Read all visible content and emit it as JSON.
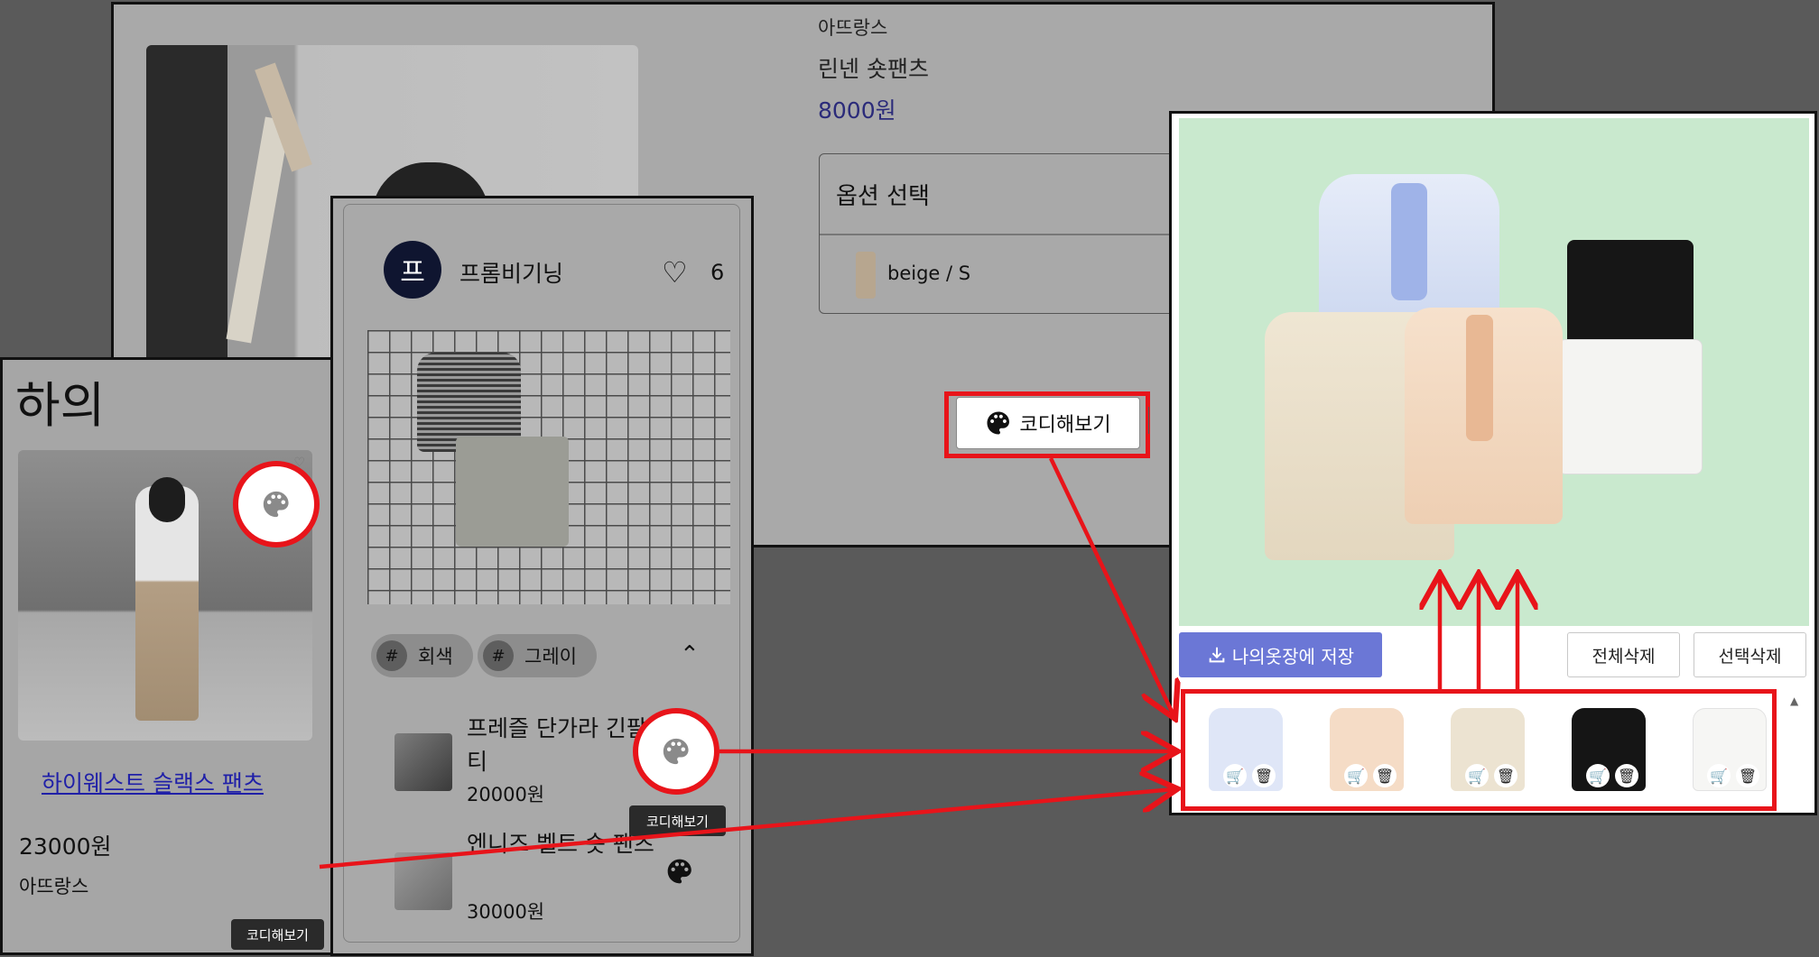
{
  "product_page": {
    "brand": "아뜨랑스",
    "name": "린넨 숏팬츠",
    "price": "8000원",
    "option_label": "옵션 선택",
    "option_value": "beige / S",
    "coordi_button": "코디해보기"
  },
  "category_card": {
    "title": "하의",
    "product_name": "하이웨스트 슬랙스 팬츠",
    "price": "23000원",
    "brand": "아뜨랑스",
    "tooltip": "코디해보기"
  },
  "coordi_card": {
    "avatar_initial": "프",
    "user_name": "프롬비기닝",
    "likes": "6",
    "tags": [
      "회색",
      "그레이"
    ],
    "tag_symbol": "#",
    "items": [
      {
        "name": "프레즐 단가라 긴팔티",
        "price": "20000원"
      },
      {
        "name": "엔니즈 벨트 숏 팬츠",
        "price": "30000원"
      }
    ],
    "tooltip": "코디해보기"
  },
  "editor": {
    "save_button": "나의옷장에 저장",
    "delete_all_button": "전체삭제",
    "delete_selected_button": "선택삭제",
    "strip_items": [
      {
        "icon": "blue-blouse",
        "color": "#dfe6f7"
      },
      {
        "icon": "peach-blouse",
        "color": "#f5dcc6"
      },
      {
        "icon": "cream-shirt",
        "color": "#ece3d1"
      },
      {
        "icon": "black-shorts",
        "color": "#151515"
      },
      {
        "icon": "white-shorts",
        "color": "#f6f6f4"
      }
    ],
    "canvas_color": "#c9e9ce"
  },
  "colors": {
    "highlight": "#e8141a",
    "save_button": "#6b77d6",
    "panel_dim": "#a9a9a9",
    "backdrop": "#5a5a5a"
  }
}
